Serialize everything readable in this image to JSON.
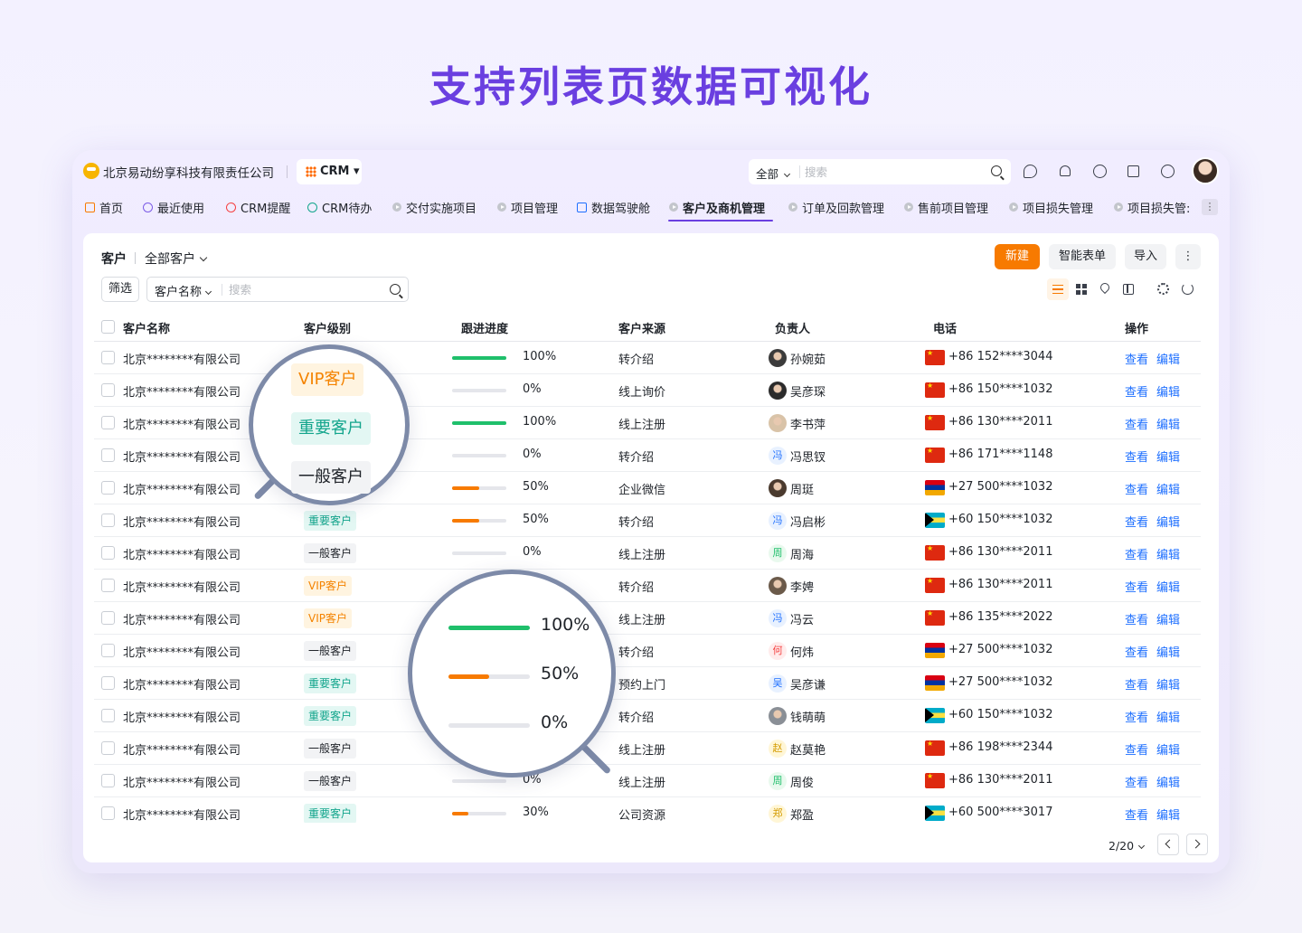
{
  "headline": "支持列表页数据可视化",
  "topbar": {
    "company": "北京易动纷享科技有限责任公司",
    "app_name": "CRM",
    "search_scope": "全部",
    "search_placeholder": "搜索"
  },
  "nav": {
    "items": [
      {
        "label": "首页",
        "icon": "home-icon",
        "color": "#f77a00"
      },
      {
        "label": "最近使用",
        "icon": "clock-icon",
        "color": "#7b5be6"
      },
      {
        "label": "CRM提醒",
        "icon": "bell-icon",
        "color": "#f53f3f"
      },
      {
        "label": "CRM待办",
        "icon": "check-icon",
        "color": "#13a58c"
      },
      {
        "label": "交付实施项目",
        "icon": "play-icon"
      },
      {
        "label": "项目管理",
        "icon": "play-icon"
      },
      {
        "label": "数据驾驶舱",
        "icon": "dashboard-icon",
        "color": "#1e6fff"
      },
      {
        "label": "客户及商机管理",
        "icon": "play-icon",
        "active": true
      },
      {
        "label": "订单及回款管理",
        "icon": "play-icon"
      },
      {
        "label": "售前项目管理",
        "icon": "play-icon"
      },
      {
        "label": "项目损失管理",
        "icon": "play-icon"
      },
      {
        "label": "项目损失管:",
        "icon": "play-icon"
      }
    ]
  },
  "panel": {
    "title": "客户",
    "view": "全部客户",
    "buttons": {
      "new": "新建",
      "smart_form": "智能表单",
      "import": "导入"
    },
    "filter": "筛选",
    "search_field": "客户名称",
    "search_placeholder": "搜索"
  },
  "table": {
    "headers": [
      "客户名称",
      "客户级别",
      "跟进进度",
      "客户来源",
      "负责人",
      "电话",
      "操作"
    ],
    "action_view": "查看",
    "action_edit": "编辑",
    "rows": [
      {
        "name": "北京********有限公司",
        "level": "",
        "level_type": "",
        "progress": 100,
        "progress_label": "100%",
        "source": "转介绍",
        "owner": "孙婉茹",
        "owner_avatar": "",
        "phone": "+86 152****3044",
        "flag": "cn"
      },
      {
        "name": "北京********有限公司",
        "level": "",
        "level_type": "",
        "progress": 0,
        "progress_label": "0%",
        "source": "线上询价",
        "owner": "吴彦琛",
        "owner_avatar": "",
        "phone": "+86 150****1032",
        "flag": "cn"
      },
      {
        "name": "北京********有限公司",
        "level": "",
        "level_type": "",
        "progress": 100,
        "progress_label": "100%",
        "source": "线上注册",
        "owner": "李书萍",
        "owner_avatar": "",
        "phone": "+86 130****2011",
        "flag": "cn"
      },
      {
        "name": "北京********有限公司",
        "level": "",
        "level_type": "",
        "progress": 0,
        "progress_label": "0%",
        "source": "转介绍",
        "owner": "冯思钗",
        "owner_avatar": "冯",
        "phone": "+86 171****1148",
        "flag": "cn"
      },
      {
        "name": "北京********有限公司",
        "level": "",
        "level_type": "",
        "progress": 50,
        "progress_label": "50%",
        "source": "企业微信",
        "owner": "周珽",
        "owner_avatar": "",
        "phone": "+27 500****1032",
        "flag": "am"
      },
      {
        "name": "北京********有限公司",
        "level": "重要客户",
        "level_type": "imp",
        "progress": 50,
        "progress_label": "50%",
        "source": "转介绍",
        "owner": "冯启彬",
        "owner_avatar": "冯",
        "phone": "+60 150****1032",
        "flag": "bs"
      },
      {
        "name": "北京********有限公司",
        "level": "一般客户",
        "level_type": "norm",
        "progress": 0,
        "progress_label": "0%",
        "source": "线上注册",
        "owner": "周海",
        "owner_avatar": "周",
        "phone": "+86 130****2011",
        "flag": "cn"
      },
      {
        "name": "北京********有限公司",
        "level": "VIP客户",
        "level_type": "vip",
        "progress": null,
        "progress_label": "",
        "source": "转介绍",
        "owner": "李娉",
        "owner_avatar": "",
        "phone": "+86 130****2011",
        "flag": "cn"
      },
      {
        "name": "北京********有限公司",
        "level": "VIP客户",
        "level_type": "vip",
        "progress": null,
        "progress_label": "",
        "source": "线上注册",
        "owner": "冯云",
        "owner_avatar": "冯",
        "phone": "+86 135****2022",
        "flag": "cn"
      },
      {
        "name": "北京********有限公司",
        "level": "一般客户",
        "level_type": "norm",
        "progress": null,
        "progress_label": "",
        "source": "转介绍",
        "owner": "何炜",
        "owner_avatar": "何",
        "phone": "+27 500****1032",
        "flag": "am"
      },
      {
        "name": "北京********有限公司",
        "level": "重要客户",
        "level_type": "imp",
        "progress": null,
        "progress_label": "",
        "source": "预约上门",
        "owner": "吴彦谦",
        "owner_avatar": "吴",
        "phone": "+27 500****1032",
        "flag": "am"
      },
      {
        "name": "北京********有限公司",
        "level": "重要客户",
        "level_type": "imp",
        "progress": null,
        "progress_label": "",
        "source": "转介绍",
        "owner": "钱萌萌",
        "owner_avatar": "",
        "phone": "+60 150****1032",
        "flag": "bs"
      },
      {
        "name": "北京********有限公司",
        "level": "一般客户",
        "level_type": "norm",
        "progress": null,
        "progress_label": "",
        "source": "线上注册",
        "owner": "赵莫艳",
        "owner_avatar": "赵",
        "phone": "+86 198****2344",
        "flag": "cn"
      },
      {
        "name": "北京********有限公司",
        "level": "一般客户",
        "level_type": "norm",
        "progress": 0,
        "progress_label": "0%",
        "source": "线上注册",
        "owner": "周俊",
        "owner_avatar": "周",
        "phone": "+86 130****2011",
        "flag": "cn"
      },
      {
        "name": "北京********有限公司",
        "level": "重要客户",
        "level_type": "imp",
        "progress": 30,
        "progress_label": "30%",
        "source": "公司资源",
        "owner": "郑盈",
        "owner_avatar": "郑",
        "phone": "+60 500****3017",
        "flag": "bs"
      }
    ]
  },
  "pager": {
    "label": "2/20"
  },
  "lens_levels": {
    "tags": [
      {
        "label": "VIP客户",
        "type": "vip"
      },
      {
        "label": "重要客户",
        "type": "imp"
      },
      {
        "label": "一般客户",
        "type": "norm"
      }
    ]
  },
  "lens_progress": {
    "bars": [
      {
        "value": 100,
        "label": "100%"
      },
      {
        "value": 50,
        "label": "50%"
      },
      {
        "value": 0,
        "label": "0%"
      }
    ]
  },
  "colors": {
    "accent": "#f77a00",
    "progress_full": "#1fbf6b",
    "progress_partial": "#f77a00",
    "link": "#1e6fff",
    "headline": "#6a3fe0"
  }
}
